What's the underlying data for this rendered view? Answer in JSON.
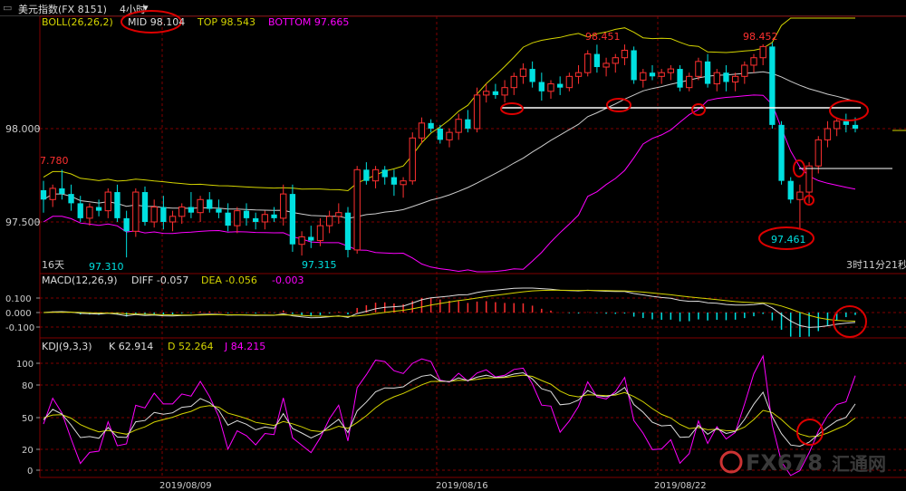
{
  "window": {
    "title": "美元指数(FX 8151)",
    "period": "4小时",
    "dropdown_glyph": "▾"
  },
  "boll": {
    "label": "BOLL(26,26,2)",
    "mid": "MID 98.104",
    "top": "TOP 98.543",
    "bottom": "BOTTOM 97.665",
    "price_ticks": [
      "98.000",
      "97.500"
    ],
    "left_edge_value": "7.780",
    "annotations": {
      "high1": "98.451",
      "high2": "98.452",
      "low1": "97.310",
      "low2": "97.315",
      "low3": "97.461"
    },
    "timeframe_label": "16天",
    "countdown": "3时11分21秒"
  },
  "macd": {
    "label": "MACD(12,26,9)",
    "diff": "DIFF -0.057",
    "dea": "DEA -0.056",
    "macd": "-0.003",
    "ticks": [
      "0.100",
      "0.000",
      "-0.100"
    ]
  },
  "kdj": {
    "label": "KDJ(9,3,3)",
    "k": "K 62.914",
    "d": "D 52.264",
    "j": "J 84.215",
    "ticks": [
      "100",
      "80",
      "50",
      "20",
      "0"
    ]
  },
  "x_dates": [
    "2019/08/09",
    "2019/08/16",
    "2019/08/22"
  ],
  "watermark": {
    "brand": "FX678",
    "cn": "汇通网"
  },
  "colors": {
    "up": "#ff3030",
    "down": "#00e0e0",
    "mid_line": "#cccccc",
    "top_line": "#d4d400",
    "bottom_line": "#ff00ff",
    "annotation": "#dd0000",
    "axis": "#800000"
  },
  "chart_data": {
    "type": "candlestick",
    "price_axis_ticks": [
      98.0,
      97.5
    ],
    "candles": [
      [
        97.67,
        97.72,
        97.55,
        97.62
      ],
      [
        97.62,
        97.7,
        97.58,
        97.68
      ],
      [
        97.68,
        97.78,
        97.62,
        97.65
      ],
      [
        97.65,
        97.7,
        97.56,
        97.6
      ],
      [
        97.6,
        97.64,
        97.5,
        97.52
      ],
      [
        97.52,
        97.6,
        97.48,
        97.58
      ],
      [
        97.58,
        97.62,
        97.53,
        97.56
      ],
      [
        97.56,
        97.68,
        97.52,
        97.66
      ],
      [
        97.66,
        97.7,
        97.5,
        97.52
      ],
      [
        97.52,
        97.56,
        97.31,
        97.45
      ],
      [
        97.45,
        97.68,
        97.42,
        97.66
      ],
      [
        97.66,
        97.69,
        97.48,
        97.5
      ],
      [
        97.5,
        97.62,
        97.47,
        97.58
      ],
      [
        97.58,
        97.64,
        97.46,
        97.5
      ],
      [
        97.5,
        97.56,
        97.45,
        97.53
      ],
      [
        97.53,
        97.6,
        97.49,
        97.58
      ],
      [
        97.58,
        97.66,
        97.52,
        97.55
      ],
      [
        97.55,
        97.64,
        97.5,
        97.62
      ],
      [
        97.62,
        97.66,
        97.55,
        97.57
      ],
      [
        97.57,
        97.62,
        97.52,
        97.55
      ],
      [
        97.55,
        97.6,
        97.45,
        97.48
      ],
      [
        97.48,
        97.58,
        97.44,
        97.56
      ],
      [
        97.56,
        97.6,
        97.48,
        97.52
      ],
      [
        97.52,
        97.55,
        97.46,
        97.5
      ],
      [
        97.5,
        97.56,
        97.46,
        97.54
      ],
      [
        97.54,
        97.58,
        97.5,
        97.52
      ],
      [
        97.52,
        97.7,
        97.48,
        97.65
      ],
      [
        97.65,
        97.7,
        97.34,
        97.38
      ],
      [
        97.38,
        97.45,
        97.32,
        97.42
      ],
      [
        97.42,
        97.48,
        97.36,
        97.4
      ],
      [
        97.4,
        97.52,
        97.37,
        97.48
      ],
      [
        97.48,
        97.56,
        97.44,
        97.53
      ],
      [
        97.53,
        97.6,
        97.49,
        97.55
      ],
      [
        97.55,
        97.58,
        97.31,
        97.35
      ],
      [
        97.35,
        97.8,
        97.33,
        97.78
      ],
      [
        97.78,
        97.82,
        97.7,
        97.72
      ],
      [
        97.72,
        97.8,
        97.68,
        97.78
      ],
      [
        97.78,
        97.8,
        97.7,
        97.74
      ],
      [
        97.74,
        97.78,
        97.64,
        97.7
      ],
      [
        97.7,
        97.74,
        97.63,
        97.72
      ],
      [
        97.72,
        97.98,
        97.7,
        97.95
      ],
      [
        97.95,
        98.06,
        97.92,
        98.03
      ],
      [
        98.03,
        98.05,
        97.98,
        98.0
      ],
      [
        98.0,
        98.02,
        97.92,
        97.94
      ],
      [
        97.94,
        98.0,
        97.9,
        97.98
      ],
      [
        97.98,
        98.08,
        97.94,
        98.05
      ],
      [
        98.05,
        98.1,
        97.98,
        98.0
      ],
      [
        98.0,
        98.22,
        97.98,
        98.18
      ],
      [
        98.18,
        98.24,
        98.14,
        98.2
      ],
      [
        98.2,
        98.24,
        98.16,
        98.18
      ],
      [
        98.18,
        98.26,
        98.14,
        98.22
      ],
      [
        98.22,
        98.3,
        98.18,
        98.28
      ],
      [
        98.28,
        98.35,
        98.24,
        98.32
      ],
      [
        98.32,
        98.36,
        98.22,
        98.25
      ],
      [
        98.25,
        98.3,
        98.15,
        98.2
      ],
      [
        98.2,
        98.26,
        98.16,
        98.24
      ],
      [
        98.24,
        98.28,
        98.18,
        98.22
      ],
      [
        98.22,
        98.3,
        98.2,
        98.28
      ],
      [
        98.28,
        98.34,
        98.24,
        98.3
      ],
      [
        98.3,
        98.42,
        98.28,
        98.4
      ],
      [
        98.4,
        98.45,
        98.3,
        98.33
      ],
      [
        98.33,
        98.38,
        98.28,
        98.35
      ],
      [
        98.35,
        98.4,
        98.3,
        98.38
      ],
      [
        98.38,
        98.451,
        98.34,
        98.42
      ],
      [
        98.42,
        98.44,
        98.24,
        98.26
      ],
      [
        98.26,
        98.32,
        98.22,
        98.3
      ],
      [
        98.3,
        98.34,
        98.26,
        98.28
      ],
      [
        98.28,
        98.32,
        98.24,
        98.3
      ],
      [
        98.3,
        98.34,
        98.26,
        98.32
      ],
      [
        98.32,
        98.34,
        98.2,
        98.22
      ],
      [
        98.22,
        98.3,
        98.2,
        98.28
      ],
      [
        98.28,
        98.38,
        98.26,
        98.36
      ],
      [
        98.36,
        98.4,
        98.22,
        98.24
      ],
      [
        98.24,
        98.32,
        98.2,
        98.3
      ],
      [
        98.3,
        98.34,
        98.2,
        98.25
      ],
      [
        98.25,
        98.3,
        98.2,
        98.28
      ],
      [
        98.28,
        98.36,
        98.24,
        98.34
      ],
      [
        98.34,
        98.4,
        98.3,
        98.38
      ],
      [
        98.38,
        98.452,
        98.34,
        98.44
      ],
      [
        98.44,
        98.46,
        98.0,
        98.02
      ],
      [
        98.02,
        98.04,
        97.7,
        97.72
      ],
      [
        97.72,
        97.74,
        97.6,
        97.62
      ],
      [
        97.62,
        97.7,
        97.461,
        97.66
      ],
      [
        97.66,
        97.82,
        97.6,
        97.8
      ],
      [
        97.8,
        97.96,
        97.76,
        97.94
      ],
      [
        97.94,
        98.04,
        97.9,
        98.0
      ],
      [
        98.0,
        98.06,
        97.96,
        98.04
      ],
      [
        98.04,
        98.08,
        97.98,
        98.02
      ],
      [
        98.02,
        98.06,
        97.98,
        98.0
      ]
    ]
  }
}
